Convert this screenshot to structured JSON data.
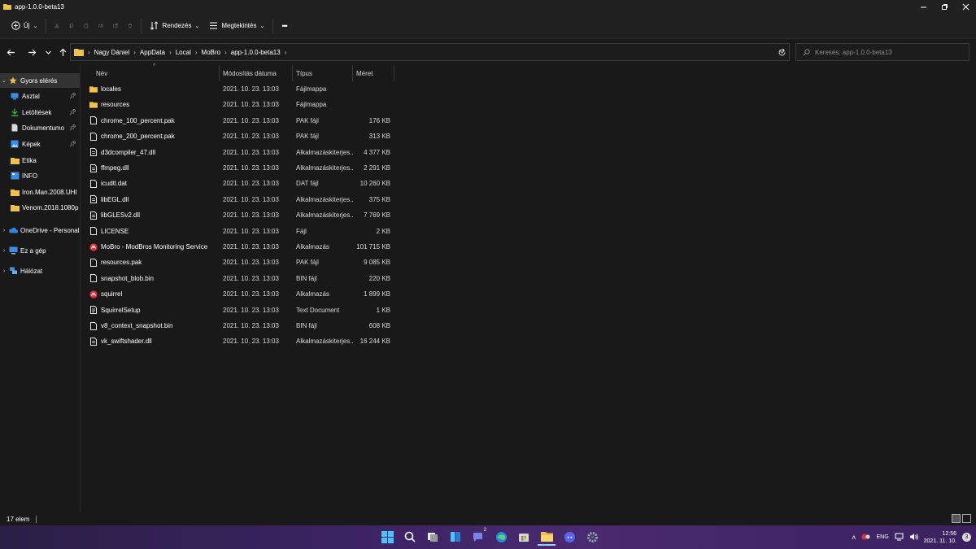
{
  "window": {
    "title": "app-1.0.0-beta13"
  },
  "toolbar": {
    "new_label": "Új",
    "sort_label": "Rendezés",
    "view_label": "Megtekintés",
    "more": "•••"
  },
  "address": {
    "crumbs": [
      "Nagy Dániel",
      "AppData",
      "Local",
      "MoBro",
      "app-1.0.0-beta13"
    ],
    "search_placeholder": "Keresés: app-1.0.0-beta13"
  },
  "sidebar": {
    "items": [
      {
        "label": "Gyors elérés",
        "icon": "star-icon"
      },
      {
        "label": "Asztal",
        "icon": "desktop-icon"
      },
      {
        "label": "Letöltések",
        "icon": "download-icon"
      },
      {
        "label": "Dokumentumo",
        "icon": "document-icon"
      },
      {
        "label": "Képek",
        "icon": "pictures-icon"
      },
      {
        "label": "Etika",
        "icon": "folder-icon"
      },
      {
        "label": "INFO",
        "icon": "folder-blue-icon"
      },
      {
        "label": "Iron.Man.2008.UHI",
        "icon": "folder-icon"
      },
      {
        "label": "Venom.2018.1080p",
        "icon": "folder-icon"
      },
      {
        "label": "OneDrive - Personal",
        "icon": "cloud-icon"
      },
      {
        "label": "Ez a gép",
        "icon": "computer-icon"
      },
      {
        "label": "Hálózat",
        "icon": "network-icon"
      }
    ]
  },
  "columns": {
    "name": "Név",
    "modified": "Módosítás dátuma",
    "type": "Típus",
    "size": "Méret"
  },
  "files": [
    {
      "name": "locales",
      "modified": "2021. 10. 23. 13:03",
      "type": "Fájlmappa",
      "size": "",
      "icon": "folder"
    },
    {
      "name": "resources",
      "modified": "2021. 10. 23. 13:03",
      "type": "Fájlmappa",
      "size": "",
      "icon": "folder"
    },
    {
      "name": "chrome_100_percent.pak",
      "modified": "2021. 10. 23. 13:03",
      "type": "PAK fájl",
      "size": "176 KB",
      "icon": "file"
    },
    {
      "name": "chrome_200_percent.pak",
      "modified": "2021. 10. 23. 13:03",
      "type": "PAK fájl",
      "size": "313 KB",
      "icon": "file"
    },
    {
      "name": "d3dcompiler_47.dll",
      "modified": "2021. 10. 23. 13:03",
      "type": "Alkalmazáskiterjes...",
      "size": "4 377 KB",
      "icon": "dll"
    },
    {
      "name": "ffmpeg.dll",
      "modified": "2021. 10. 23. 13:03",
      "type": "Alkalmazáskiterjes...",
      "size": "2 291 KB",
      "icon": "dll"
    },
    {
      "name": "icudtl.dat",
      "modified": "2021. 10. 23. 13:03",
      "type": "DAT fájl",
      "size": "10 260 KB",
      "icon": "file"
    },
    {
      "name": "libEGL.dll",
      "modified": "2021. 10. 23. 13:03",
      "type": "Alkalmazáskiterjes...",
      "size": "375 KB",
      "icon": "dll"
    },
    {
      "name": "libGLESv2.dll",
      "modified": "2021. 10. 23. 13:03",
      "type": "Alkalmazáskiterjes...",
      "size": "7 769 KB",
      "icon": "dll"
    },
    {
      "name": "LICENSE",
      "modified": "2021. 10. 23. 13:03",
      "type": "Fájl",
      "size": "2 KB",
      "icon": "file"
    },
    {
      "name": "MoBro - ModBros Monitoring Service",
      "modified": "2021. 10. 23. 13:03",
      "type": "Alkalmazás",
      "size": "101 715 KB",
      "icon": "app"
    },
    {
      "name": "resources.pak",
      "modified": "2021. 10. 23. 13:03",
      "type": "PAK fájl",
      "size": "9 085 KB",
      "icon": "file"
    },
    {
      "name": "snapshot_blob.bin",
      "modified": "2021. 10. 23. 13:03",
      "type": "BIN fájl",
      "size": "220 KB",
      "icon": "file"
    },
    {
      "name": "squirrel",
      "modified": "2021. 10. 23. 13:03",
      "type": "Alkalmazás",
      "size": "1 899 KB",
      "icon": "app"
    },
    {
      "name": "SquirrelSetup",
      "modified": "2021. 10. 23. 13:03",
      "type": "Text Document",
      "size": "1 KB",
      "icon": "text"
    },
    {
      "name": "v8_context_snapshot.bin",
      "modified": "2021. 10. 23. 13:03",
      "type": "BIN fájl",
      "size": "608 KB",
      "icon": "file"
    },
    {
      "name": "vk_swiftshader.dll",
      "modified": "2021. 10. 23. 13:03",
      "type": "Alkalmazáskiterjes...",
      "size": "16 244 KB",
      "icon": "dll"
    }
  ],
  "status": {
    "count": "17 elem"
  },
  "taskbar": {
    "lang": "ENG",
    "time": "12:56",
    "date": "2021. 11. 10.",
    "notifications": "3",
    "teams_badge": "2"
  },
  "colors": {
    "accent": "#3d2466",
    "folder": "#f0c24a",
    "app_red": "#e0313b"
  }
}
